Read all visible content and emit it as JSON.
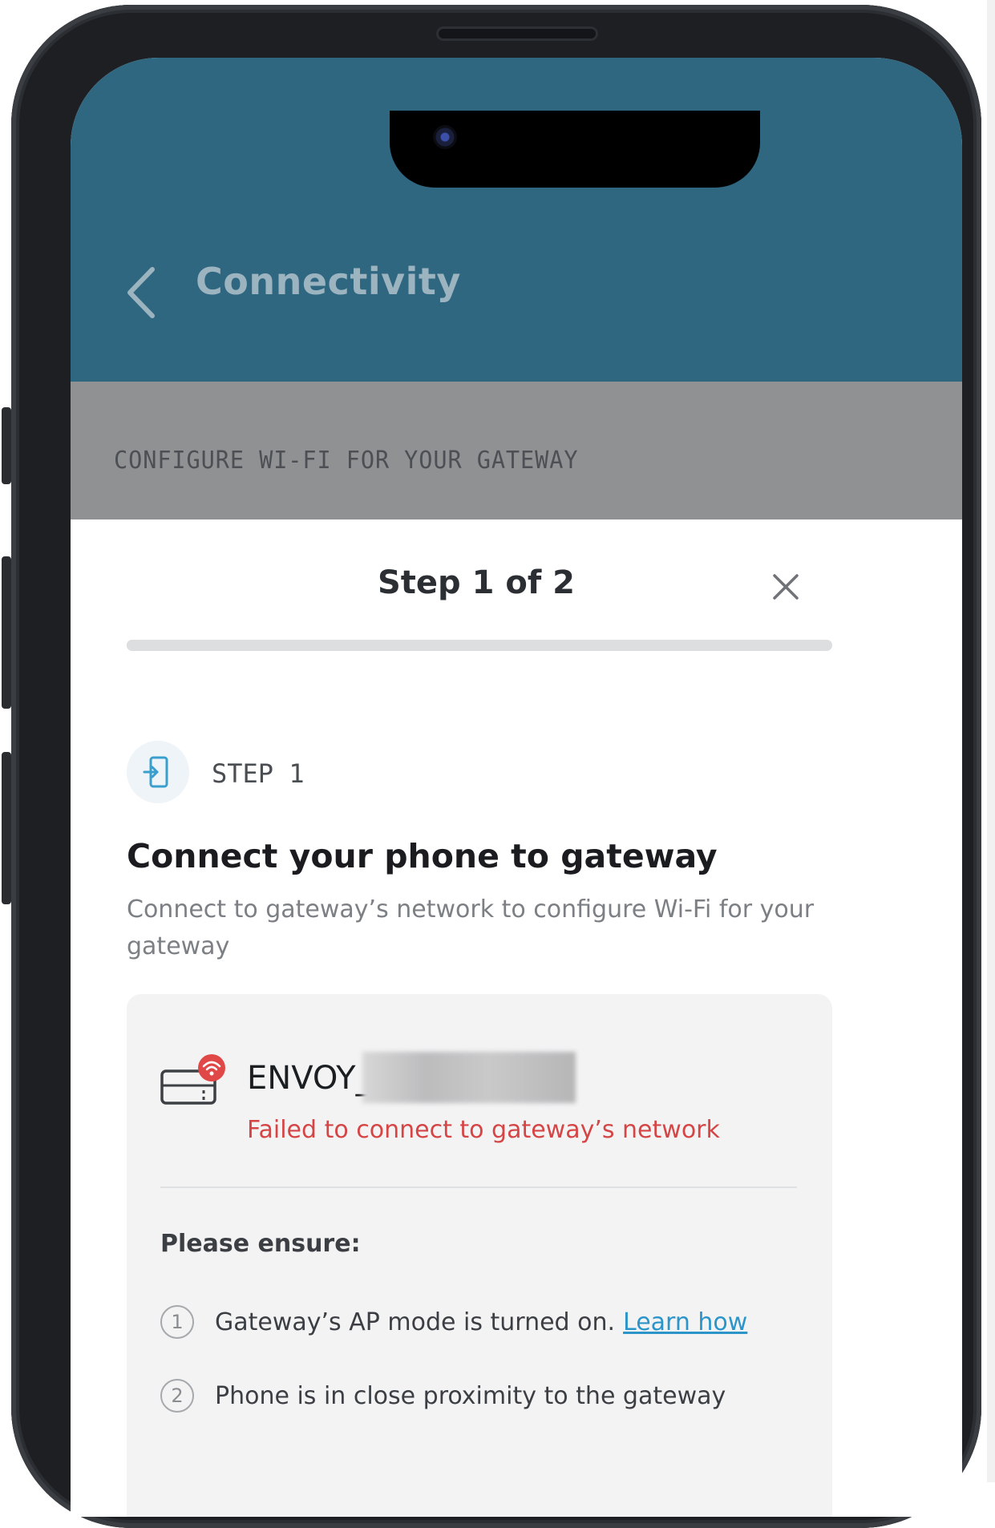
{
  "header": {
    "back_icon": "chevron-left-icon",
    "title": "Connectivity",
    "section_label": "CONFIGURE WI-FI FOR YOUR GATEWAY"
  },
  "sheet": {
    "title": "Step 1 of 2",
    "close_icon": "close-icon",
    "progress": {
      "current_step": 1,
      "total_steps": 2
    },
    "step": {
      "icon": "phone-connect-icon",
      "label": "STEP 1",
      "heading": "Connect your phone to gateway",
      "description": "Connect to gateway’s network to configure Wi-Fi for your gateway"
    },
    "network_card": {
      "icon": "gateway-wifi-error-icon",
      "network_name": "ENVOY_",
      "error_message": "Failed to connect to gateway’s network",
      "ensure_label": "Please ensure:",
      "items": [
        {
          "number": "1",
          "text": "Gateway’s AP mode is turned on.",
          "link": "Learn how"
        },
        {
          "number": "2",
          "text": "Phone is in close proximity to the gateway"
        }
      ]
    }
  },
  "colors": {
    "header_bg": "#2f6680",
    "overlay_band": "#8f9193",
    "error": "#d64545",
    "link": "#2b95c9"
  }
}
